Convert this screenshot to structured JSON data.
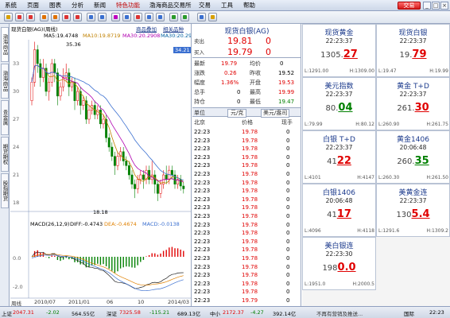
{
  "menu": {
    "items": [
      "系统",
      "页面",
      "图表",
      "分析",
      "新闻",
      "特色功能",
      "渤海商品交易所",
      "交易",
      "工具",
      "帮助"
    ],
    "trade_button": "交易"
  },
  "chart": {
    "title": "现货白银(AG)(周线)",
    "ma_labels": [
      {
        "text": "MA5:19.4748",
        "color": "#000000"
      },
      {
        "text": "MA10:19.8719",
        "color": "#c08000"
      },
      {
        "text": "MA30:20.2908",
        "color": "#b000b0"
      },
      {
        "text": "MA30:20.2908",
        "color": "#0060a0"
      }
    ],
    "subtabs": [
      "商品叠加",
      "相关品种"
    ],
    "price_badge": "34.21",
    "y_labels": [
      "33",
      "30",
      "27",
      "24",
      "21",
      "18"
    ],
    "high_label": "35.36",
    "low_label": "18.18",
    "macd_legend": {
      "macd": "MACD(26,12,9)",
      "diff": "DIFF:-0.4743",
      "dea": "DEA:-0.4674",
      "macd_val": "MACD:-0.0138"
    },
    "macd_y": [
      "0.0",
      "-2.0"
    ],
    "x_labels": [
      "2010/07",
      "2011/01",
      "06",
      "10",
      "2014/03"
    ],
    "x_axis_caption": "周线",
    "candles": [
      [
        29.0,
        31.0,
        28.5,
        31.5
      ],
      [
        31.0,
        34.5,
        30.5,
        35.36
      ],
      [
        34.5,
        33.0,
        32.0,
        35.0
      ],
      [
        33.0,
        31.5,
        30.5,
        33.5
      ],
      [
        31.5,
        32.5,
        31.0,
        33.5
      ],
      [
        32.5,
        30.0,
        29.5,
        33.0
      ],
      [
        30.0,
        31.0,
        29.0,
        31.5
      ],
      [
        31.0,
        33.0,
        30.5,
        33.5
      ],
      [
        33.0,
        32.0,
        31.0,
        33.5
      ],
      [
        32.0,
        29.5,
        28.5,
        32.5
      ],
      [
        29.5,
        30.5,
        29.0,
        31.0
      ],
      [
        30.5,
        31.5,
        30.0,
        32.5
      ],
      [
        31.5,
        32.0,
        31.0,
        33.0
      ],
      [
        32.0,
        30.5,
        29.5,
        32.5
      ],
      [
        30.5,
        31.0,
        30.0,
        31.5
      ],
      [
        31.0,
        29.0,
        28.0,
        31.5
      ],
      [
        29.0,
        30.0,
        28.5,
        30.5
      ],
      [
        30.0,
        28.5,
        27.5,
        30.5
      ],
      [
        28.5,
        29.0,
        28.0,
        29.5
      ],
      [
        29.0,
        27.0,
        26.5,
        29.5
      ],
      [
        27.0,
        28.0,
        26.5,
        28.5
      ],
      [
        28.0,
        28.5,
        27.5,
        29.0
      ],
      [
        28.5,
        27.5,
        27.0,
        29.0
      ],
      [
        27.5,
        28.0,
        27.0,
        28.5
      ],
      [
        28.0,
        26.5,
        26.0,
        28.5
      ],
      [
        26.5,
        27.0,
        26.0,
        27.5
      ],
      [
        27.0,
        25.0,
        24.5,
        27.5
      ],
      [
        25.0,
        24.0,
        23.5,
        25.5
      ],
      [
        24.0,
        23.0,
        22.5,
        24.5
      ],
      [
        23.0,
        22.0,
        21.0,
        23.5
      ],
      [
        22.0,
        23.0,
        21.5,
        23.5
      ],
      [
        23.0,
        23.5,
        22.5,
        24.0
      ],
      [
        23.5,
        22.5,
        22.0,
        24.0
      ],
      [
        22.5,
        22.0,
        21.5,
        23.0
      ],
      [
        22.0,
        21.0,
        20.5,
        22.5
      ],
      [
        21.0,
        20.0,
        19.5,
        21.5
      ],
      [
        20.0,
        19.5,
        18.5,
        20.5
      ],
      [
        19.5,
        20.5,
        19.0,
        21.0
      ],
      [
        20.5,
        21.0,
        20.0,
        21.5
      ],
      [
        21.0,
        20.5,
        19.5,
        21.5
      ],
      [
        20.5,
        21.5,
        20.0,
        22.0
      ],
      [
        21.5,
        20.5,
        20.0,
        22.0
      ],
      [
        20.5,
        21.0,
        20.0,
        22.5
      ],
      [
        21.0,
        20.0,
        19.0,
        21.5
      ],
      [
        20.0,
        19.0,
        18.18,
        20.5
      ],
      [
        19.0,
        20.0,
        18.5,
        20.5
      ],
      [
        20.0,
        21.0,
        19.5,
        21.5
      ],
      [
        21.0,
        20.5,
        20.0,
        22.0
      ],
      [
        20.5,
        21.5,
        20.0,
        22.0
      ],
      [
        21.5,
        21.0,
        20.5,
        22.0
      ],
      [
        21.0,
        20.0,
        19.5,
        21.5
      ],
      [
        20.0,
        20.5,
        19.5,
        21.0
      ],
      [
        20.5,
        19.8,
        19.3,
        21.0
      ],
      [
        19.8,
        19.5,
        19.0,
        20.2
      ]
    ]
  },
  "quote": {
    "title": "现货白银(AG)",
    "sell_label": "卖出",
    "sell_price": "19.81",
    "sell_qty": "0",
    "buy_label": "买入",
    "buy_price": "19.79",
    "buy_qty": "0",
    "stats": [
      {
        "l1": "最新",
        "v1": "19.79",
        "c1": "#e00000",
        "l2": "均价",
        "v2": "0",
        "c2": "#000000"
      },
      {
        "l1": "涨跌",
        "v1": "0.26",
        "c1": "#e00000",
        "l2": "昨收",
        "v2": "19.52",
        "c2": "#000000"
      },
      {
        "l1": "幅度",
        "v1": "1.36%",
        "c1": "#e00000",
        "l2": "开盘",
        "v2": "19.53",
        "c2": "#e00000"
      },
      {
        "l1": "总手",
        "v1": "0",
        "c1": "#000000",
        "l2": "最高",
        "v2": "19.99",
        "c2": "#e00000"
      },
      {
        "l1": "持仓",
        "v1": "0",
        "c1": "#000000",
        "l2": "最低",
        "v2": "19.47",
        "c2": "#008000"
      }
    ],
    "unit_bar": {
      "left": "单位",
      "mid": "元/克",
      "right": "美元/盎司"
    },
    "tick_header": {
      "time": "北京",
      "price": "价格",
      "vol": "现手"
    },
    "ticks": [
      {
        "time": "22:23",
        "price": "19.78",
        "vol": "0"
      },
      {
        "time": "22:23",
        "price": "19.78",
        "vol": "0"
      },
      {
        "time": "22:23",
        "price": "19.78",
        "vol": "0"
      },
      {
        "time": "22:23",
        "price": "19.78",
        "vol": "0"
      },
      {
        "time": "22:23",
        "price": "19.78",
        "vol": "0"
      },
      {
        "time": "22:23",
        "price": "19.78",
        "vol": "0"
      },
      {
        "time": "22:23",
        "price": "19.78",
        "vol": "0"
      },
      {
        "time": "22:23",
        "price": "19.78",
        "vol": "0"
      },
      {
        "time": "22:23",
        "price": "19.78",
        "vol": "0"
      },
      {
        "time": "22:23",
        "price": "19.78",
        "vol": "0"
      },
      {
        "time": "22:23",
        "price": "19.78",
        "vol": "0"
      },
      {
        "time": "22:23",
        "price": "19.78",
        "vol": "0"
      },
      {
        "time": "22:23",
        "price": "19.78",
        "vol": "0"
      },
      {
        "time": "22:23",
        "price": "19.78",
        "vol": "0"
      },
      {
        "time": "22:23",
        "price": "19.78",
        "vol": "0"
      },
      {
        "time": "22:23",
        "price": "19.78",
        "vol": "0"
      },
      {
        "time": "22:23",
        "price": "19.78",
        "vol": "0"
      },
      {
        "time": "22:23",
        "price": "19.78",
        "vol": "0"
      },
      {
        "time": "22:23",
        "price": "19.78",
        "vol": "0"
      },
      {
        "time": "22:23",
        "price": "19.78",
        "vol": "0"
      },
      {
        "time": "22:23",
        "price": "19.79",
        "vol": "0"
      }
    ]
  },
  "tiles": [
    {
      "name": "现货黄金",
      "time": "22:23:37",
      "base": "1305.",
      "tail": "27",
      "color": "#e00000",
      "low": "L:1291.00",
      "high": "H:1309.00"
    },
    {
      "name": "现货白银",
      "time": "22:23:37",
      "base": "19.",
      "tail": "79",
      "color": "#e00000",
      "low": "L:19.47",
      "high": "H:19.99"
    },
    {
      "name": "美元指数",
      "time": "22:23:37",
      "base": "80.",
      "tail": "04",
      "color": "#008000",
      "low": "L:79.99",
      "high": "H:80.12"
    },
    {
      "name": "黄金 T+D",
      "time": "22:23:37",
      "base": "261.",
      "tail": "30",
      "color": "#e00000",
      "low": "L:260.90",
      "high": "H:261.75"
    },
    {
      "name": "白银 T+D",
      "time": "22:23:37",
      "base": "41",
      "tail": "22",
      "color": "#e00000",
      "low": "L:4101",
      "high": "H:4147"
    },
    {
      "name": "黄金1406",
      "time": "20:06:48",
      "base": "260.",
      "tail": "35",
      "color": "#008000",
      "low": "L:260.30",
      "high": "H:261.50"
    },
    {
      "name": "白银1406",
      "time": "20:06:48",
      "base": "41",
      "tail": "17",
      "color": "#e00000",
      "low": "L:4096",
      "high": "H:4118"
    },
    {
      "name": "美黄金连",
      "time": "22:23:37",
      "base": "130",
      "tail": "5.4",
      "color": "#e00000",
      "low": "L:1291.6",
      "high": "H:1309.2"
    },
    {
      "name": "美白银连",
      "time": "22:23:30",
      "base": "198",
      "tail": "0.0",
      "color": "#e00000",
      "low": "L:1951.0",
      "high": "H:2000.5"
    }
  ],
  "status": {
    "items": [
      {
        "text": "上证",
        "color": "#000000"
      },
      {
        "text": "2047.31",
        "color": "#e00000"
      },
      {
        "text": "-2.02",
        "color": "#008000"
      },
      {
        "text": "564.55亿",
        "color": "#000000"
      },
      {
        "text": "深证",
        "color": "#000000"
      },
      {
        "text": "7325.58",
        "color": "#e00000"
      },
      {
        "text": "-115.21",
        "color": "#008000"
      },
      {
        "text": "689.13亿",
        "color": "#000000"
      },
      {
        "text": "中小",
        "color": "#000000"
      },
      {
        "text": "2172.37",
        "color": "#e00000"
      },
      {
        "text": "-4.27",
        "color": "#008000"
      },
      {
        "text": "392.14亿",
        "color": "#000000"
      },
      {
        "text": "不再有营销及推送...",
        "color": "#333333"
      },
      {
        "text": "国际",
        "color": "#000000"
      },
      {
        "text": "22:23",
        "color": "#000000"
      }
    ]
  },
  "left_tabs": [
    "渤海商品",
    "渤海商品",
    "贵金属",
    "期货期权",
    "股指期货"
  ]
}
